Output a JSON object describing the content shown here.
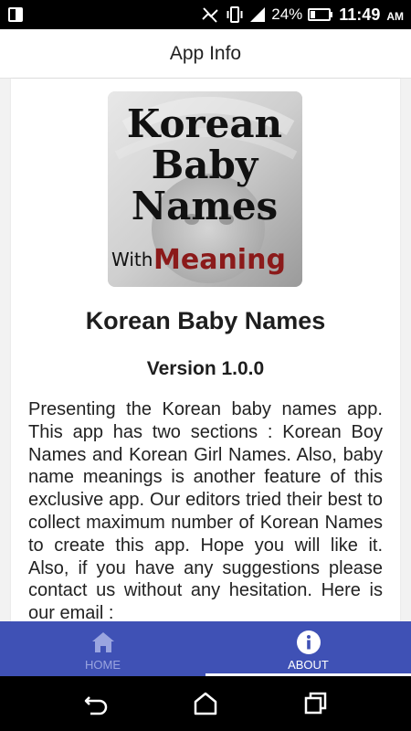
{
  "status_bar": {
    "battery_percent": "24%",
    "time": "11:49",
    "ampm": "AM",
    "icons": [
      "screen-mirror-icon",
      "signal-off-icon",
      "vibrate-icon",
      "cell-signal-icon",
      "battery-icon"
    ]
  },
  "app_bar": {
    "title": "App Info"
  },
  "logo": {
    "line1": "Korean",
    "line2": "Baby",
    "line3": "Names",
    "with": "With",
    "meaning": "Meaning",
    "meaning_color": "#8b1a1a"
  },
  "content": {
    "app_name": "Korean Baby Names",
    "version": "Version 1.0.0",
    "description": "Presenting the Korean baby names app. This app has two sections : Korean Boy Names and Korean Girl Names. Also, baby name meanings is another feature of this exclusive app. Our editors tried their best to collect maximum number of Korean Names to create this app. Hope you will like it. Also, if you have any suggestions please contact us without any hesitation. Here is our email :"
  },
  "bottom_nav": {
    "background": "#3f51b5",
    "items": [
      {
        "label": "HOME",
        "icon": "home-icon",
        "active": false
      },
      {
        "label": "ABOUT",
        "icon": "info-icon",
        "active": true
      }
    ]
  },
  "system_nav": {
    "buttons": [
      "back-icon",
      "home-outline-icon",
      "recents-icon"
    ]
  }
}
